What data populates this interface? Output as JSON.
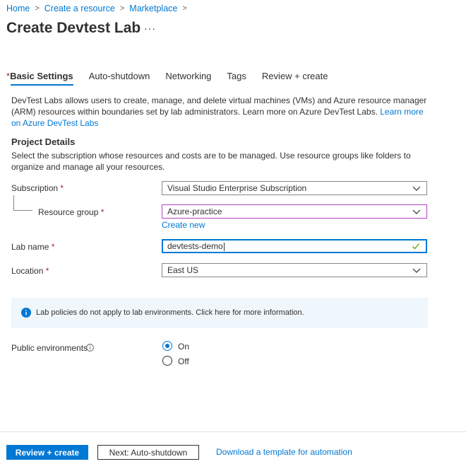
{
  "breadcrumb": [
    "Home",
    "Create a resource",
    "Marketplace"
  ],
  "page": {
    "title": "Create Devtest Lab",
    "more": "···"
  },
  "tabs": [
    {
      "label": "Basic Settings",
      "required": "*"
    },
    {
      "label": "Auto-shutdown"
    },
    {
      "label": "Networking"
    },
    {
      "label": "Tags"
    },
    {
      "label": "Review + create"
    }
  ],
  "description": {
    "text": "DevTest Labs allows users to create, manage, and delete virtual machines (VMs) and Azure resource manager (ARM) resources within boundaries set by lab administrators. Learn more on Azure DevTest Labs.",
    "link": "Learn more on Azure DevTest Labs"
  },
  "project": {
    "title": "Project Details",
    "description": "Select the subscription whose resources and costs are to be managed. Use resource groups like folders to organize and manage all your resources."
  },
  "form": {
    "required_mark": "*",
    "subscription": {
      "label": "Subscription",
      "value": "Visual Studio Enterprise Subscription"
    },
    "resource_group": {
      "label": "Resource group",
      "value": "Azure-practice",
      "create_new": "Create new"
    },
    "lab_name": {
      "label": "Lab name",
      "value": "devtests-demo"
    },
    "location": {
      "label": "Location",
      "value": "East US"
    }
  },
  "info": {
    "text": "Lab policies do not apply to lab environments. Click here for more information."
  },
  "public_env": {
    "label": "Public environments",
    "options": [
      "On",
      "Off"
    ],
    "selected": "On"
  },
  "footer": {
    "review_create": "Review + create",
    "next": "Next: Auto-shutdown",
    "download": "Download a template for automation"
  },
  "colors": {
    "accent": "#0078d4",
    "required": "#a4262c",
    "focus_purple": "#b146c2",
    "info_bg": "#eff6fc",
    "valid_check": "#57a300"
  }
}
